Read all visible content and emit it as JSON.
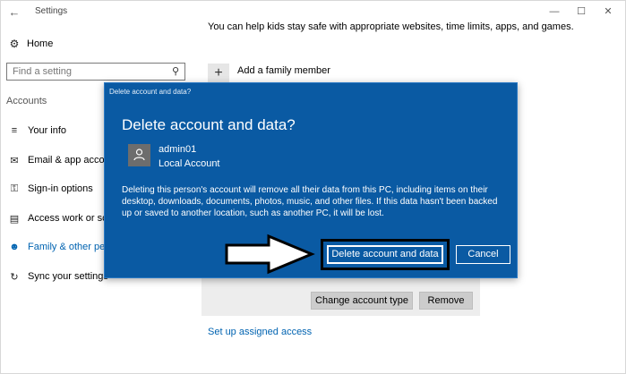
{
  "titlebar": {
    "app_title": "Settings",
    "back_icon": "arrow-left-icon",
    "minimize_icon": "minimize-icon",
    "maximize_icon": "maximize-icon",
    "close_icon": "close-icon"
  },
  "sidebar": {
    "home_label": "Home",
    "search_placeholder": "Find a setting",
    "section_label": "Accounts",
    "items": [
      {
        "label": "Your info",
        "icon": "person-card-icon"
      },
      {
        "label": "Email & app accounts",
        "icon": "envelope-icon"
      },
      {
        "label": "Sign-in options",
        "icon": "key-icon"
      },
      {
        "label": "Access work or school",
        "icon": "briefcase-icon"
      },
      {
        "label": "Family & other people",
        "icon": "person-add-icon",
        "active": true
      },
      {
        "label": "Sync your settings",
        "icon": "sync-icon"
      }
    ]
  },
  "main": {
    "intro_text": "You can help kids stay safe with appropriate websites, time limits, apps, and games.",
    "add_member_label": "Add a family member",
    "change_type_label": "Change account type",
    "remove_label": "Remove",
    "assigned_access_link": "Set up assigned access"
  },
  "dialog": {
    "window_title": "Delete account and data?",
    "heading": "Delete account and data?",
    "account_name": "admin01",
    "account_type": "Local Account",
    "body": "Deleting this person's account will remove all their data from this PC, including items on their desktop, downloads, documents, photos, music, and other files. If this data hasn't been backed up or saved to another location, such as another PC, it will be lost.",
    "delete_label": "Delete account and data",
    "cancel_label": "Cancel"
  },
  "colors": {
    "accent": "#0063b1",
    "dialog_bg": "#0a5aa3"
  }
}
